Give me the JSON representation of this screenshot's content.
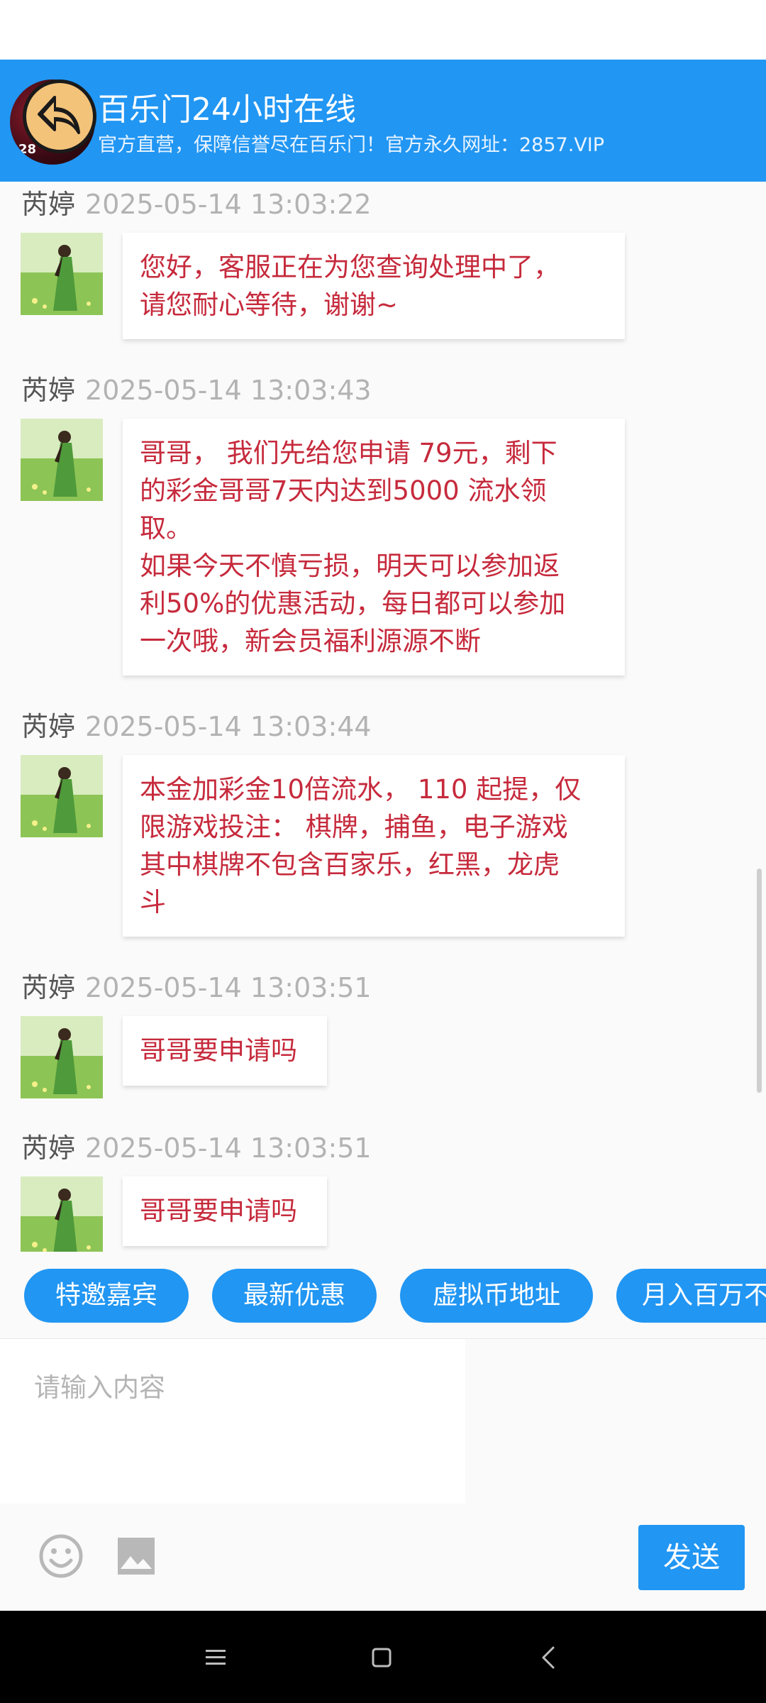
{
  "header": {
    "title": "百乐门24小时在线",
    "subtitle": "官方直营，保障信誉尽在百乐门！官方永久网址：2857.VIP",
    "avatar_number": "28"
  },
  "messages": [
    {
      "sender": "芮婷",
      "time": "2025-05-14 13:03:22",
      "text": "您好，客服正在为您查询处理中了，\n请您耐心等待，谢谢~"
    },
    {
      "sender": "芮婷",
      "time": "2025-05-14 13:03:43",
      "text": "哥哥， 我们先给您申请 79元，剩下\n的彩金哥哥7天内达到5000 流水领\n取。\n如果今天不慎亏损，明天可以参加返\n利50%的优惠活动，每日都可以参加\n一次哦，新会员福利源源不断"
    },
    {
      "sender": "芮婷",
      "time": "2025-05-14 13:03:44",
      "text": "本金加彩金10倍流水， 110 起提，仅\n限游戏投注： 棋牌，捕鱼，电子游戏\n其中棋牌不包含百家乐，红黑，龙虎\n斗"
    },
    {
      "sender": "芮婷",
      "time": "2025-05-14 13:03:51",
      "text": "哥哥要申请吗"
    },
    {
      "sender": "芮婷",
      "time": "2025-05-14 13:03:51",
      "text": "哥哥要申请吗"
    }
  ],
  "quick_replies": [
    "特邀嘉宾",
    "最新优惠",
    "虚拟币地址",
    "月入百万不"
  ],
  "input": {
    "placeholder": "请输入内容",
    "value": ""
  },
  "toolbar": {
    "emoji_icon": "smiley-icon",
    "image_icon": "image-icon",
    "send_label": "发送"
  },
  "colors": {
    "accent": "#2196f3",
    "message_text": "#c62a3c",
    "timestamp": "#b3b3b3"
  }
}
